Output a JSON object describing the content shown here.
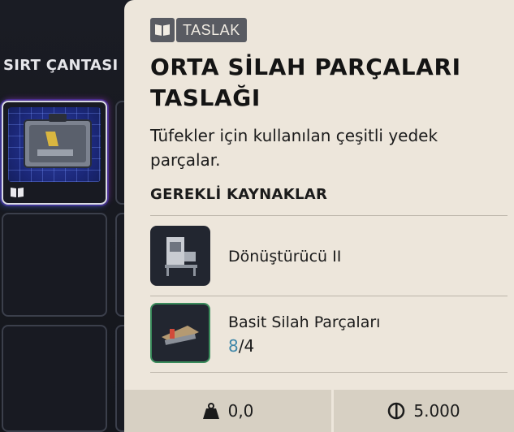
{
  "inventory": {
    "label": "SIRT ÇANTASI"
  },
  "item": {
    "tag": "TASLAK",
    "title": "ORTA SİLAH PARÇALARI TASLAĞI",
    "description": "Tüfekler için kullanılan çeşitli yedek parçalar.",
    "requirements_label": "GEREKLİ KAYNAKLAR",
    "requirements": [
      {
        "name": "Dönüştürücü II",
        "icon": "workbench-icon"
      },
      {
        "name": "Basit Silah Parçaları",
        "have": "8",
        "sep": "/",
        "need": "4",
        "icon": "weapon-parts-icon"
      }
    ],
    "footer": {
      "weight": "0,0",
      "price": "5.000"
    }
  },
  "colors": {
    "accent_have": "#3e86a8",
    "panel_bg": "#ede6db"
  }
}
